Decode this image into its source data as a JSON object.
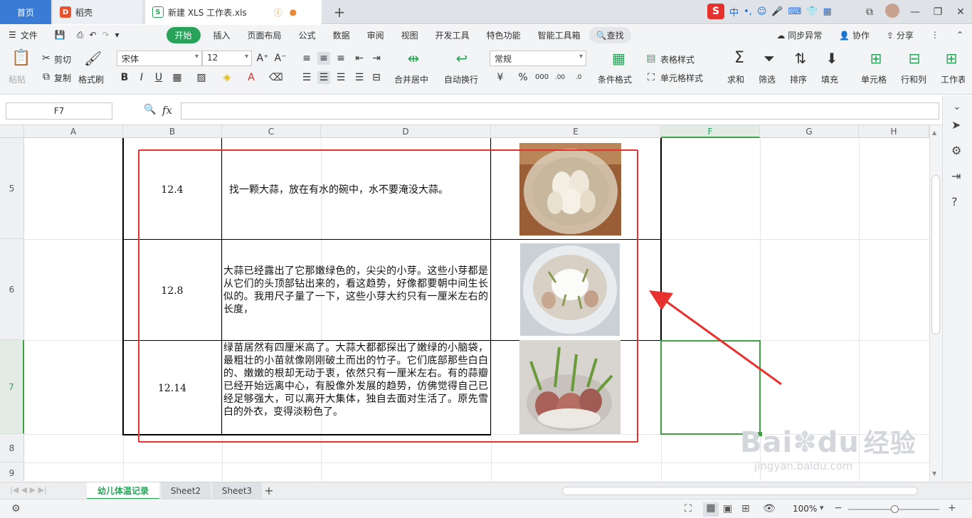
{
  "tabs": {
    "home": "首页",
    "daoke": "稻壳",
    "doc": "新建 XLS 工作表.xls"
  },
  "ime": {
    "lang": "中"
  },
  "menu": [
    "文件",
    "开始",
    "插入",
    "页面布局",
    "公式",
    "数据",
    "审阅",
    "视图",
    "开发工具",
    "特色功能",
    "智能工具箱",
    "查找"
  ],
  "menu_right": [
    "同步异常",
    "协作",
    "分享"
  ],
  "ribbon": {
    "paste": "粘贴",
    "cut": "剪切",
    "copy": "复制",
    "format_painter": "格式刷",
    "font_name": "宋体",
    "font_size": "12",
    "merge_center": "合并居中",
    "wrap": "自动换行",
    "number_format": "常规",
    "cond_format": "条件格式",
    "table_style": "表格样式",
    "cell_style": "单元格样式",
    "sum": "求和",
    "filter": "筛选",
    "sort": "排序",
    "fill": "填充",
    "cell": "单元格",
    "row_col": "行和列",
    "worksheet": "工作表"
  },
  "formula_bar": {
    "name_box": "F7",
    "fx": "fx"
  },
  "columns": [
    "A",
    "B",
    "C",
    "D",
    "E",
    "F",
    "G",
    "H"
  ],
  "rows": [
    {
      "num": "5",
      "date": "12.4",
      "text": "找一颗大蒜，放在有水的碗中，水不要淹没大蒜。"
    },
    {
      "num": "6",
      "date": "12.8",
      "text": "大蒜已经露出了它那嫩绿色的，尖尖的小芽。这些小芽都是从它们的头顶部钻出来的，看这趋势，好像都要朝中间生长似的。我用尺子量了一下，这些小芽大约只有一厘米左右的长度，"
    },
    {
      "num": "7",
      "date": "12.14",
      "text": "绿苗居然有四厘米高了。大蒜大都都探出了嫩绿的小脑袋，最粗壮的小苗就像刚刚破土而出的竹子。它们底部那些白白的、嫩嫩的根却无动于衷，依然只有一厘米左右。有的蒜瓣已经开始远离中心，有股像外发展的趋势，仿佛觉得自己已经足够强大，可以离开大集体，独自去面对生活了。原先雪白的外衣，变得淡粉色了。"
    },
    {
      "num": "8"
    },
    {
      "num": "9"
    }
  ],
  "sheets": [
    "幼儿体温记录",
    "Sheet2",
    "Sheet3"
  ],
  "status": {
    "zoom": "100%"
  },
  "watermark": {
    "brand": "Bai",
    "brand2": "du",
    "cn": "经验",
    "url": "jingyan.baidu.com"
  },
  "colors": {
    "accent": "#2aa35a",
    "annotation": "#e8312f",
    "selection": "#3fa043",
    "home_tab": "#3a7bd5"
  }
}
